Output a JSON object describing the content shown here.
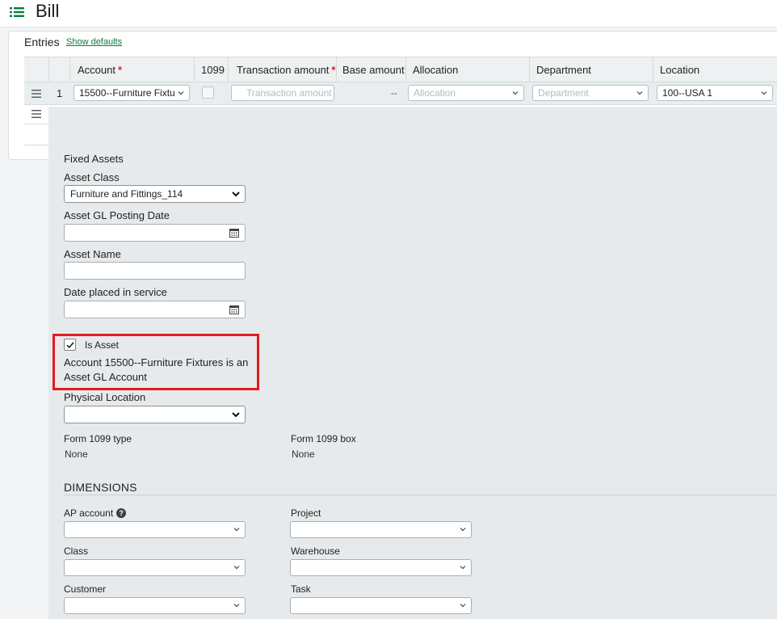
{
  "header": {
    "title": "Bill",
    "menu_icon": "list-icon"
  },
  "entries": {
    "label": "Entries",
    "show_defaults": "Show defaults",
    "columns": {
      "account": "Account",
      "c1099": "1099",
      "transaction_amount": "Transaction amount",
      "base_amount": "Base amount",
      "allocation": "Allocation",
      "department": "Department",
      "location": "Location"
    },
    "required_marker": "*",
    "row": {
      "number": "1",
      "account_value": "15500--Furniture Fixtu",
      "transaction_placeholder": "Transaction amount",
      "base_amount": "--",
      "allocation_placeholder": "Allocation",
      "department_placeholder": "Department",
      "location_value": "100--USA 1"
    }
  },
  "detail": {
    "section_title": "Fixed Assets",
    "asset_class": {
      "label": "Asset Class",
      "value": "Furniture and Fittings_114"
    },
    "asset_gl_posting_date": {
      "label": "Asset GL Posting Date",
      "value": ""
    },
    "asset_name": {
      "label": "Asset Name",
      "value": ""
    },
    "date_placed_in_service": {
      "label": "Date placed in service",
      "value": ""
    },
    "is_asset": {
      "label": "Is Asset",
      "checked": true,
      "message_line1": "Account 15500--Furniture Fixtures is an",
      "message_line2": "Asset GL Account"
    },
    "physical_location": {
      "label": "Physical Location",
      "value": ""
    },
    "form_1099_type": {
      "label": "Form 1099 type",
      "value": "None"
    },
    "form_1099_box": {
      "label": "Form 1099 box",
      "value": "None"
    },
    "dimensions": {
      "title": "DIMENSIONS",
      "ap_account": "AP account",
      "help_glyph": "?",
      "project": "Project",
      "class": "Class",
      "warehouse": "Warehouse",
      "customer": "Customer",
      "task": "Task"
    }
  },
  "colors": {
    "accent_green": "#0a7a3e",
    "highlight_red": "#e31b1b",
    "panel_bg": "#e6eaec"
  }
}
